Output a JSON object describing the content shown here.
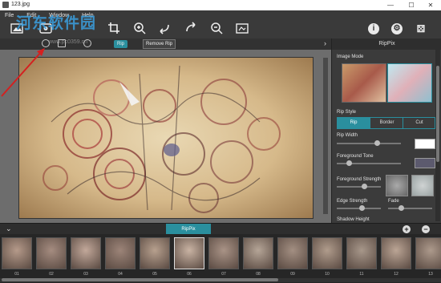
{
  "window": {
    "title": "123.jpg",
    "controls": [
      "—",
      "☐",
      "✕"
    ]
  },
  "menu": [
    "File",
    "Edit",
    "Window",
    "Help"
  ],
  "watermark": {
    "text": "河东软件园",
    "url": "www.pc0359.cn"
  },
  "toolbar": {
    "tools": [
      "open-icon",
      "image-icon",
      "crop-icon",
      "zoom-in-icon",
      "undo-icon",
      "redo-icon",
      "zoom-out-icon",
      "fit-icon"
    ],
    "right_tools": [
      "info-icon",
      "gear-icon",
      "dice-icon"
    ],
    "rip_label": "Rip",
    "remove_rip_label": "Remove Rip"
  },
  "panel": {
    "title": "RipPix",
    "image_mode_label": "Image Mode",
    "rip_style_label": "Rip Style",
    "rip_style_options": [
      "Rip",
      "Border",
      "Cut"
    ],
    "rip_style_selected": "Rip",
    "rip_width_label": "Rip Width",
    "rip_width": 0.62,
    "foreground_tone_label": "Foreground Tone",
    "foreground_tone": 0.18,
    "foreground_strength_label": "Foreground Strength",
    "foreground_strength": 0.62,
    "edge_strength_label": "Edge Strength",
    "edge_strength": 0.55,
    "fade_label": "Fade",
    "fade": 0.3,
    "shadow_height_label": "Shadow Height",
    "colors": {
      "rip_width_swatch": "#ffffff",
      "foreground_tone_swatch": "#5c5a6e",
      "accent": "#2a8f9e"
    }
  },
  "filmstrip": {
    "tab_label": "RipPix",
    "selected_index": 5,
    "frames": [
      "01",
      "02",
      "03",
      "04",
      "05",
      "06",
      "07",
      "08",
      "09",
      "10",
      "11",
      "12",
      "13"
    ]
  }
}
